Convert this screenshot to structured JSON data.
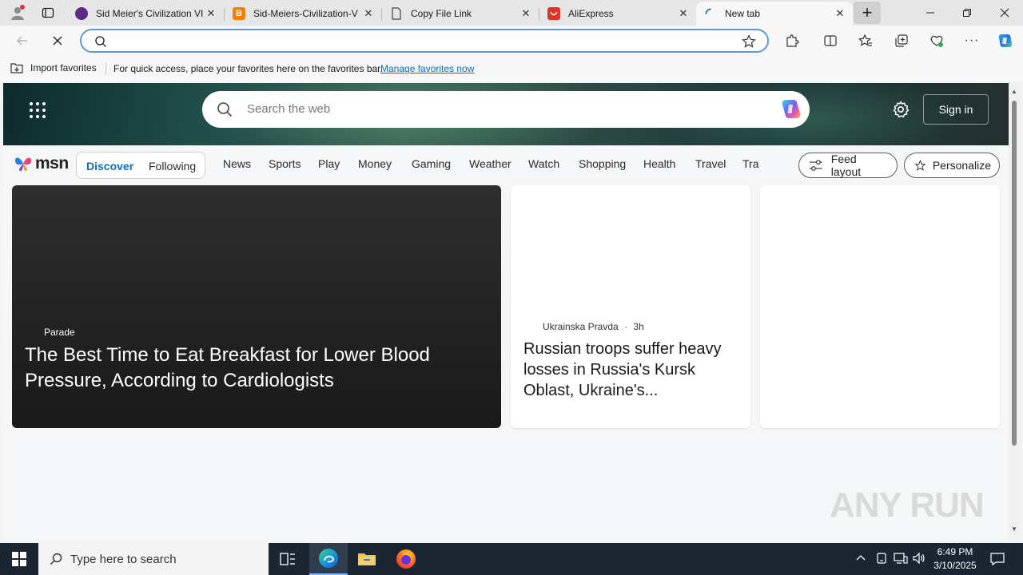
{
  "tabs": [
    {
      "title": "Sid Meier's Civilization VI",
      "icon": "civ-icon",
      "color": "#5b2a86"
    },
    {
      "title": "Sid-Meiers-Civilization-V",
      "icon": "blogger-icon",
      "color": "#f57d00"
    },
    {
      "title": "Copy File Link",
      "icon": "document-icon",
      "color": "#555555"
    },
    {
      "title": "AliExpress",
      "icon": "aliexpress-icon",
      "color": "#e43225"
    },
    {
      "title": "New tab",
      "icon": "loading-icon",
      "color": "#1a73e8"
    }
  ],
  "favorites_bar": {
    "import_label": "Import favorites",
    "message": "For quick access, place your favorites here on the favorites bar.",
    "manage_link": "Manage favorites now"
  },
  "msn": {
    "logo_text": "msn",
    "search_placeholder": "Search the web",
    "sign_in": "Sign in",
    "feed_tabs": [
      "Discover",
      "Following"
    ],
    "nav_links": [
      "News",
      "Sports",
      "Play",
      "Money",
      "Gaming",
      "Weather",
      "Watch",
      "Shopping",
      "Health",
      "Travel",
      "Tra"
    ],
    "feed_layout": "Feed layout",
    "personalize": "Personalize"
  },
  "cards": {
    "main": {
      "source": "Parade",
      "headline": "The Best Time to Eat Breakfast for Lower Blood Pressure, According to Cardiologists"
    },
    "mid": {
      "source": "Ukrainska Pravda",
      "time": "3h",
      "headline": "Russian troops suffer heavy losses in Russia's Kursk Oblast, Ukraine's..."
    }
  },
  "watermark": "ANY RUN",
  "taskbar": {
    "search_placeholder": "Type here to search",
    "time": "6:49 PM",
    "date": "3/10/2025"
  },
  "colors": {
    "accent": "#0f6cbd",
    "taskbar": "#1c2633"
  }
}
